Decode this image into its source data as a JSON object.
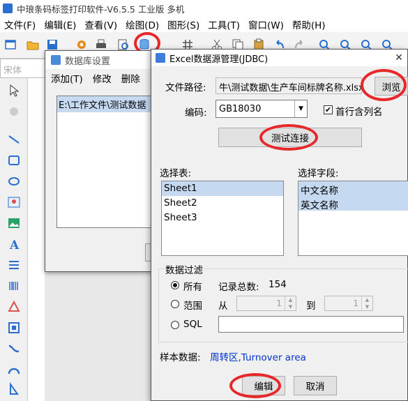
{
  "app": {
    "title": "中琅条码标签打印软件-V6.5.5 工业版 多机",
    "menu": [
      "文件(F)",
      "编辑(E)",
      "查看(V)",
      "绘图(D)",
      "图形(S)",
      "工具(T)",
      "窗口(W)",
      "帮助(H)"
    ],
    "font_placeholder": "宋体"
  },
  "db_window": {
    "title": "数据库设置",
    "menu": [
      "添加(T)",
      "修改",
      "删除"
    ],
    "list_item": "E:\\工作文件\\测试数据"
  },
  "dialog": {
    "title": "Excel数据源管理(JDBC)",
    "close": "✕",
    "file_path_label": "文件路径:",
    "file_path_value": "牛\\测试数据\\生产车间标牌名称.xlsx",
    "browse_label": "浏览",
    "encoding_label": "编码:",
    "encoding_value": "GB18030",
    "first_row_header_label": "首行含列名",
    "first_row_header_checked": true,
    "test_connection_label": "测试连接",
    "select_table_label": "选择表:",
    "tables": [
      "Sheet1",
      "Sheet2",
      "Sheet3"
    ],
    "selected_table": "Sheet1",
    "select_field_label": "选择字段:",
    "fields": [
      "中文名称",
      "英文名称"
    ],
    "filter_group_label": "数据过滤",
    "filter_all_label": "所有",
    "record_count_label": "记录总数:",
    "record_count_value": "154",
    "filter_range_label": "范围",
    "range_from_label": "从",
    "range_from_value": "1",
    "range_to_label": "到",
    "range_to_value": "1",
    "filter_sql_label": "SQL",
    "sample_label": "样本数据:",
    "sample_value": "周转区,Turnover area",
    "edit_label": "编辑",
    "cancel_label": "取消"
  },
  "colors": {
    "highlight_oval": "#e8272a",
    "selection": "#c5d9f1",
    "sample_text": "#0033cc"
  }
}
